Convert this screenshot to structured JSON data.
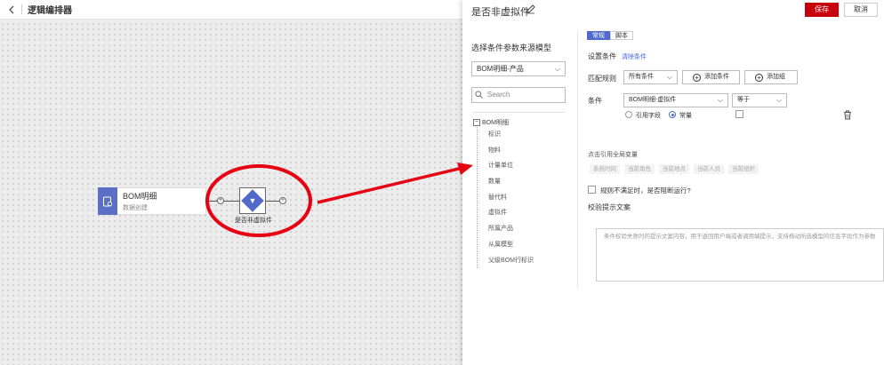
{
  "canvas": {
    "title": "逻辑编排器",
    "bom_node": {
      "name": "BOM明细",
      "subtitle": "数据创建"
    },
    "condition_node": {
      "label": "是否非虚拟件"
    }
  },
  "panel": {
    "title": "是否非虚拟件",
    "save_label": "保存",
    "cancel_label": "取消",
    "source_model_label": "选择条件参数来源模型",
    "source_model_value": "BOM明细-产品",
    "search_placeholder": "Search",
    "tree": {
      "root": "BOM明细",
      "items": [
        "标识",
        "物料",
        "计量单位",
        "数量",
        "替代料",
        "虚拟件",
        "所属产品",
        "从属模型",
        "父级BOM行标识"
      ]
    },
    "tabs": [
      {
        "label": "常规"
      },
      {
        "label": "脚本"
      }
    ],
    "set_condition_label": "设置条件",
    "clear_condition_label": "清除条件",
    "match_rule_label": "匹配规则",
    "match_rule_value": "所有条件",
    "add_condition_label": "添加条件",
    "add_group_label": "添加组",
    "condition_label": "条件",
    "condition_field_value": "BOM明细-虚拟件",
    "operator_value": "等于",
    "radio_ref_field": "引用字段",
    "radio_constant": "常量",
    "global_vars_label": "点击引用全局变量",
    "global_vars": [
      "系统时间",
      "当前角色",
      "当前地点",
      "当前人员",
      "当前组织"
    ],
    "block_label": "规则不满足时，是否阻断运行?",
    "hint_title": "校验提示文案",
    "hint_placeholder": "条件校验失败时的提示文案内容，用于返回用户端或者调用端提示，支持拖动所选模型的信息字段作为参数"
  },
  "colors": {
    "primary": "#4f6ac9",
    "save": "#c7000b",
    "annotation": "#e60012"
  }
}
